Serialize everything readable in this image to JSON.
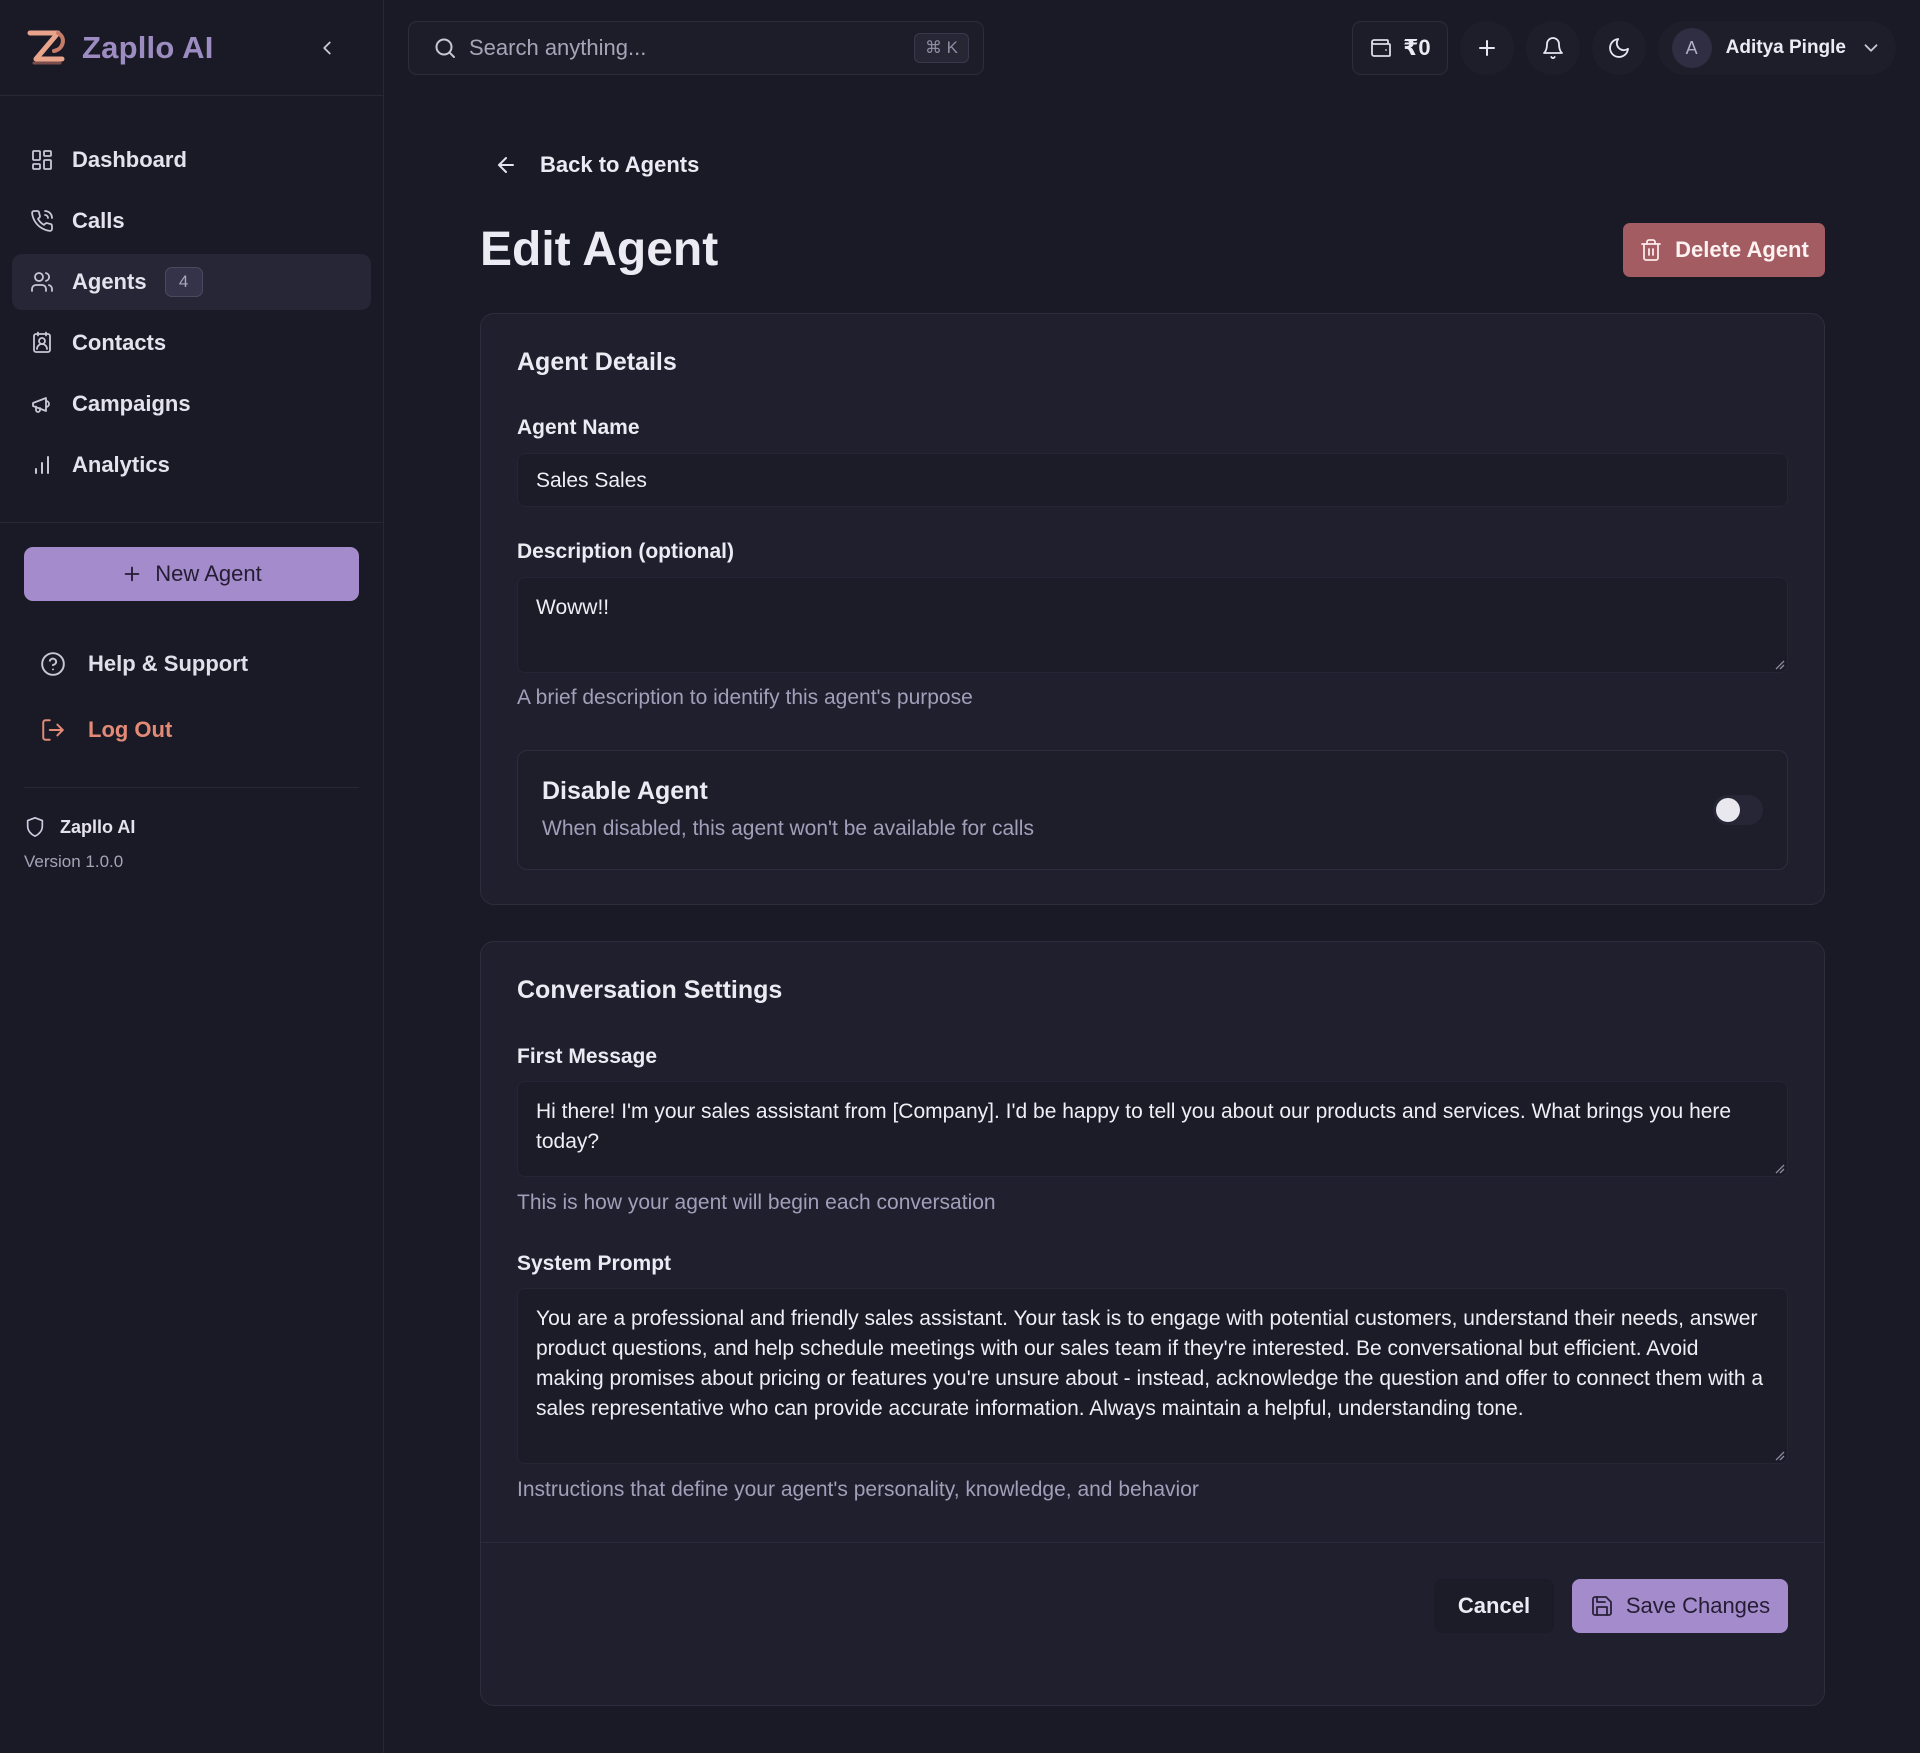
{
  "app": {
    "name": "Zapllo AI"
  },
  "sidebar": {
    "items": [
      {
        "label": "Dashboard",
        "icon": "dashboard-icon"
      },
      {
        "label": "Calls",
        "icon": "phone-icon"
      },
      {
        "label": "Agents",
        "icon": "users-icon",
        "badge": "4",
        "active": true
      },
      {
        "label": "Contacts",
        "icon": "contact-icon"
      },
      {
        "label": "Campaigns",
        "icon": "megaphone-icon"
      },
      {
        "label": "Analytics",
        "icon": "bar-chart-icon"
      }
    ],
    "new_agent_label": "New Agent",
    "help_label": "Help & Support",
    "logout_label": "Log Out",
    "footer": {
      "name": "Zapllo AI",
      "version": "Version 1.0.0"
    }
  },
  "topbar": {
    "search_placeholder": "Search anything...",
    "shortcut": "⌘ K",
    "wallet_balance": "₹0",
    "user": {
      "initial": "A",
      "name": "Aditya Pingle"
    }
  },
  "main": {
    "back_label": "Back to Agents",
    "title": "Edit Agent",
    "delete_label": "Delete Agent",
    "details": {
      "title": "Agent Details",
      "name_label": "Agent Name",
      "name_value": "Sales Sales",
      "description_label": "Description (optional)",
      "description_value": "Woww!!",
      "description_hint": "A brief description to identify this agent's purpose",
      "disable_title": "Disable Agent",
      "disable_desc": "When disabled, this agent won't be available for calls",
      "disabled": false
    },
    "conversation": {
      "title": "Conversation Settings",
      "first_message_label": "First Message",
      "first_message_value": "Hi there! I'm your sales assistant from [Company]. I'd be happy to tell you about our products and services. What brings you here today?",
      "first_message_hint": "This is how your agent will begin each conversation",
      "system_prompt_label": "System Prompt",
      "system_prompt_value": "You are a professional and friendly sales assistant. Your task is to engage with potential customers, understand their needs, answer product questions, and help schedule meetings with our sales team if they're interested. Be conversational but efficient. Avoid making promises about pricing or features you're unsure about - instead, acknowledge the question and offer to connect them with a sales representative who can provide accurate information. Always maintain a helpful, understanding tone.",
      "system_prompt_hint": "Instructions that define your agent's personality, knowledge, and behavior"
    },
    "cancel_label": "Cancel",
    "save_label": "Save Changes"
  },
  "colors": {
    "background": "#1a1a26",
    "card": "#1f1f2d",
    "accent": "#a48bcb",
    "danger": "#a35c62",
    "logout": "#e28a76",
    "muted_text": "#a39eb9"
  }
}
